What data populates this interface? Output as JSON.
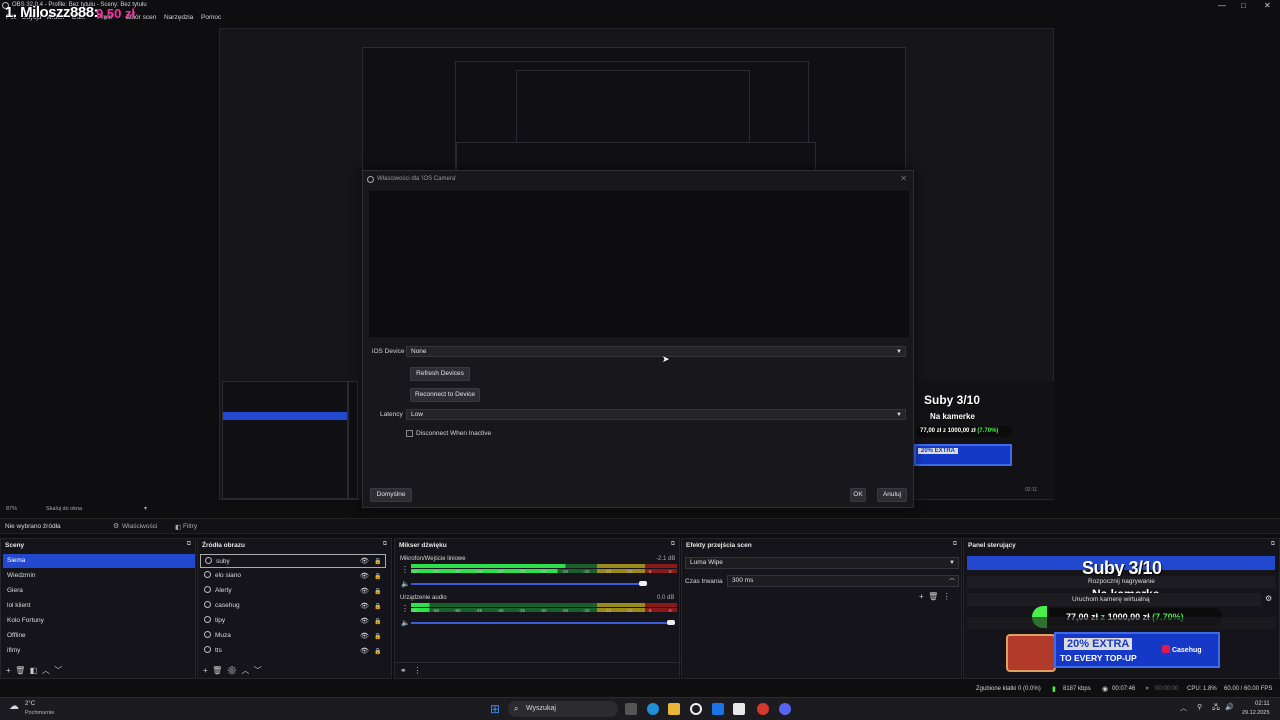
{
  "window": {
    "title": "OBS 32.0.4 - Profile: Bez tytułu - Sceny: Bez tytułu",
    "minimize": "—",
    "maximize": "□",
    "close": "✕"
  },
  "overlay": {
    "name": "1. Miloszz888:",
    "amount": "9,50 zł"
  },
  "menu": [
    "Plik",
    "Edycja",
    "Widok",
    "Doki",
    "Profil",
    "Zbiór scen",
    "Narzędzia",
    "Pomoc"
  ],
  "dialog": {
    "title": "Właściwości dla 'iOS Camera'",
    "close": "✕",
    "ios_device_label": "iOS Device",
    "ios_device_value": "None",
    "refresh_button": "Refresh Devices",
    "reconnect_button": "Reconnect to Device",
    "latency_label": "Latency",
    "latency_value": "Low",
    "disconnect_checkbox_label": "Disconnect When Inactive",
    "defaults_button": "Domyślne",
    "ok_button": "OK",
    "cancel_button": "Anuluj"
  },
  "zoom": {
    "percent": "87%",
    "mode": "Skaluj do okna"
  },
  "source_bar": {
    "no_source": "Nie wybrano źródła",
    "properties": "Właściwości",
    "filters": "Filtry"
  },
  "scenes": {
    "header": "Sceny",
    "items": [
      "Siema",
      "Wiedzmin",
      "Giera",
      "lol klient",
      "Kolo Fortuny",
      "Offline",
      "iflmy"
    ],
    "selected": "Siema"
  },
  "sources": {
    "header": "Źródła obrazu",
    "items": [
      "suby",
      "elo siano",
      "Alerty",
      "casehug",
      "tipy",
      "Muza",
      "tts"
    ]
  },
  "mixer": {
    "header": "Mikser dźwięku",
    "channels": [
      {
        "name": "Mikrofon/Wejście liniowe",
        "db": "-2.1 dB",
        "level": 0.58
      },
      {
        "name": "Urządzenie audio",
        "db": "0.0 dB",
        "level": 0.07
      }
    ],
    "scale": [
      "-60",
      "-55",
      "-50",
      "-45",
      "-40",
      "-35",
      "-30",
      "-25",
      "-20",
      "-15",
      "-10",
      "-5",
      "0"
    ]
  },
  "transitions": {
    "header": "Efekty przejścia scen",
    "transition": "Luma Wipe",
    "duration_label": "Czas trwania",
    "duration_value": "300 ms"
  },
  "control_panel": {
    "header": "Panel sterujący",
    "suby": "Suby 3/10",
    "start_recording": "Rozpocznij nagrywanie",
    "na_kamerke": "Na kamerke",
    "virtual_camera": "Uruchom kamerę wirtualną",
    "goal_current": "77,00 zł",
    "goal_sep": "z",
    "goal_target": "1000,00 zł",
    "goal_percent": "(7.70%)",
    "goal_fraction": 0.077,
    "promo_extra": "20% EXTRA",
    "promo_topup": "TO EVERY TOP-UP",
    "promo_brand": "Casehug"
  },
  "status": {
    "dropped_frames": "Zgubione klatki 0 (0.0%)",
    "bitrate": "8187 kbps",
    "stream_time": "00:07:46",
    "rec_time": "00:00:00",
    "cpu": "CPU: 1.8%",
    "fps": "60.00 / 60.00 FPS"
  },
  "taskbar": {
    "temperature": "2°C",
    "weather": "Pochmurnie",
    "search_placeholder": "Wyszukaj",
    "time": "02:11",
    "date": "29.12.2025"
  },
  "colors": {
    "accent": "#2248d0",
    "pink": "#ff2ca8",
    "green": "#47f04a",
    "meter_green": "#1fa33a",
    "meter_yellow": "#9a8a1c",
    "meter_red": "#8a1a1a"
  }
}
